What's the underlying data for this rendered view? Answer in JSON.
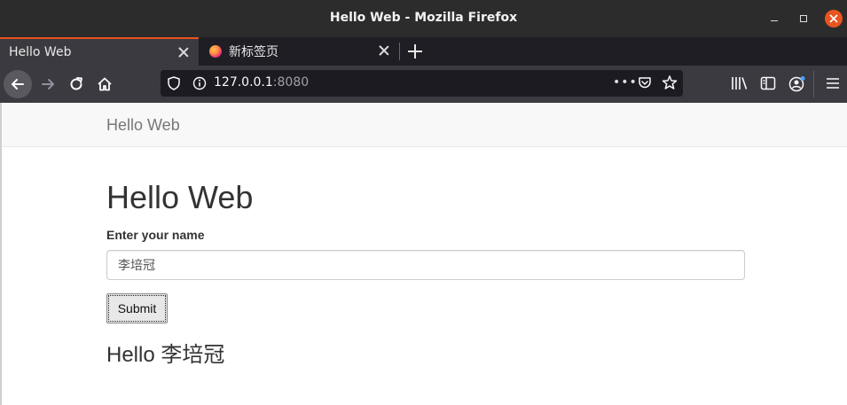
{
  "window": {
    "title": "Hello Web - Mozilla Firefox"
  },
  "tabs": [
    {
      "label": "Hello Web",
      "active": true
    },
    {
      "label": "新标签页",
      "active": false
    }
  ],
  "urlbar": {
    "host": "127.0.0.1",
    "port": ":8080"
  },
  "colors": {
    "accent": "#e95420",
    "page_bg": "#ffffff",
    "navbar_bg": "#f8f8f8"
  },
  "page": {
    "brand": "Hello Web",
    "heading": "Hello Web",
    "form": {
      "label": "Enter your name",
      "input_value": "李培冠",
      "submit_label": "Submit"
    },
    "greeting": "Hello 李培冠"
  }
}
